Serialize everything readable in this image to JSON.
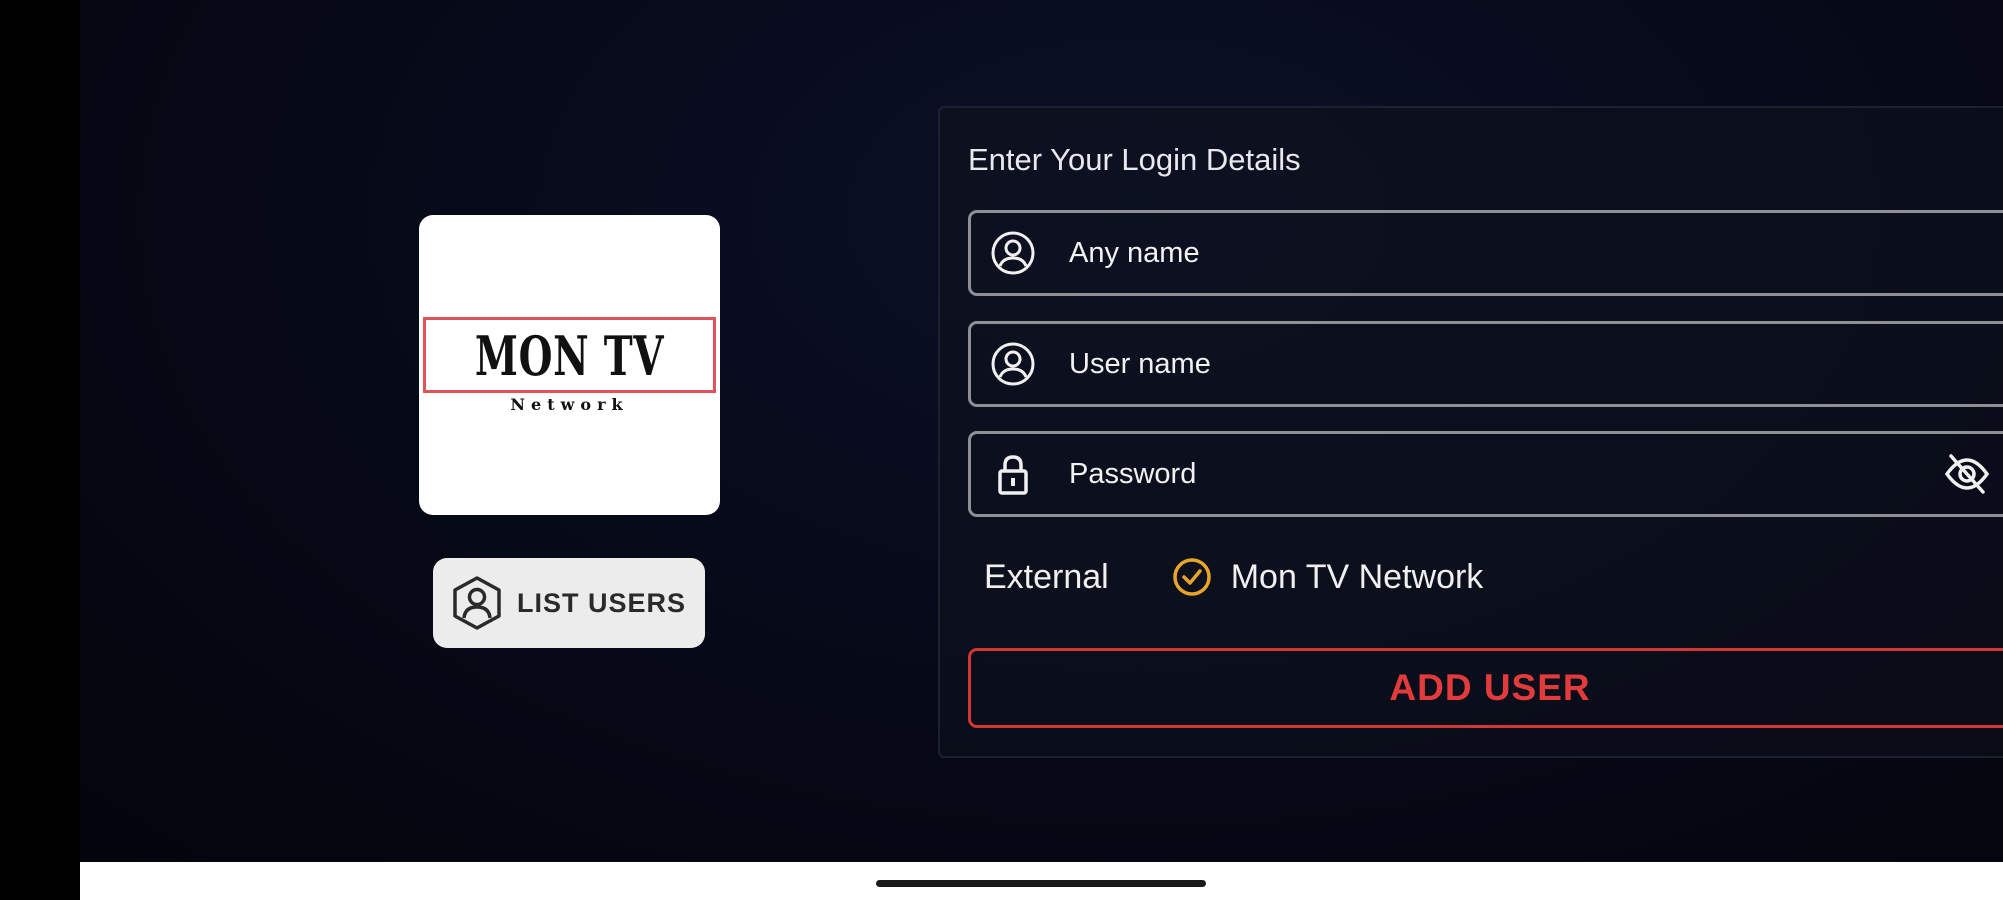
{
  "logo": {
    "title": "MON TV",
    "subtitle": "Network"
  },
  "list_users": {
    "label": "LIST USERS"
  },
  "login": {
    "title": "Enter Your Login Details",
    "fields": {
      "any_name": {
        "placeholder": "Any name",
        "icon": "user-circle-icon"
      },
      "user_name": {
        "placeholder": "User name",
        "icon": "user-circle-icon"
      },
      "password": {
        "placeholder": "Password",
        "icon": "lock-icon",
        "toggle_icon": "eye-off-icon"
      }
    },
    "source": {
      "label": "External",
      "selected_option": "Mon TV Network",
      "check_color": "#e8a52a"
    },
    "submit_label": "ADD USER",
    "accent_color": "#e23b3b"
  }
}
